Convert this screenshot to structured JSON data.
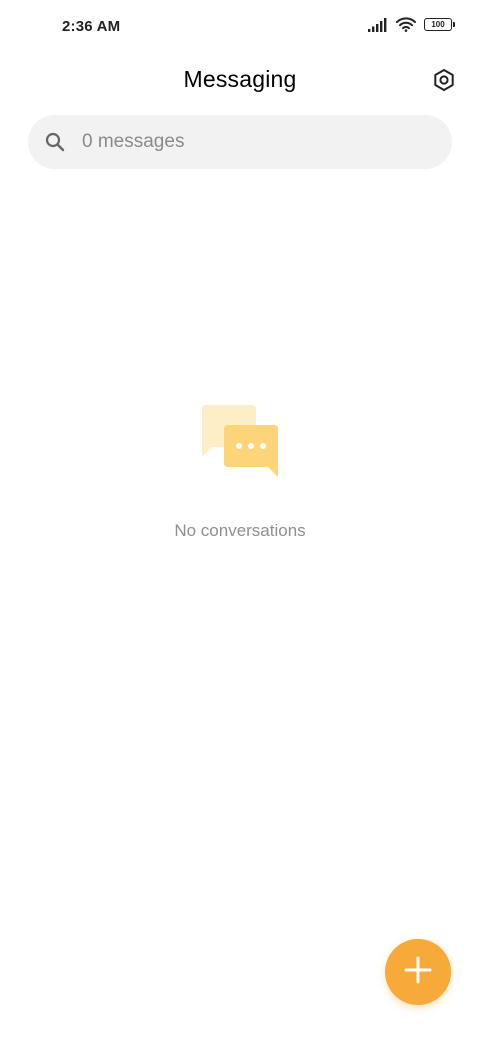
{
  "status_bar": {
    "time": "2:36 AM",
    "battery_level": "100",
    "icons": [
      "signal-icon",
      "wifi-icon",
      "battery-icon"
    ]
  },
  "header": {
    "title": "Messaging",
    "settings_icon": "gear-icon"
  },
  "search": {
    "placeholder": "0 messages",
    "value": ""
  },
  "empty_state": {
    "illustration": "chat-bubbles-icon",
    "text": "No conversations"
  },
  "fab": {
    "icon": "plus-icon"
  },
  "colors": {
    "accent": "#f7aa3a",
    "bubble_back": "#fdeec8",
    "bubble_front": "#fcd57a",
    "search_bg": "#f2f2f2",
    "muted_text": "#8f8f8f"
  }
}
